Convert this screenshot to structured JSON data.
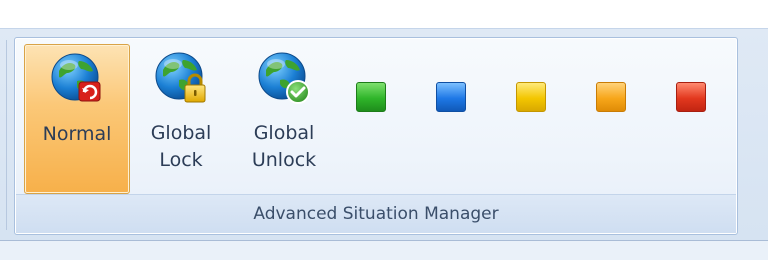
{
  "group": {
    "caption": "Advanced Situation Manager"
  },
  "buttons": [
    {
      "label": "Normal",
      "icon": "globe-refresh-icon",
      "selected": true
    },
    {
      "label": "Global\nLock",
      "icon": "globe-lock-icon",
      "selected": false
    },
    {
      "label": "Global\nUnlock",
      "icon": "globe-check-icon",
      "selected": false
    }
  ],
  "swatches": [
    {
      "name": "green",
      "color": "#2fb52a"
    },
    {
      "name": "blue",
      "color": "#1e78e6"
    },
    {
      "name": "yellow",
      "color": "#f3c600"
    },
    {
      "name": "orange",
      "color": "#f7a61a"
    },
    {
      "name": "red",
      "color": "#e2381e"
    }
  ]
}
